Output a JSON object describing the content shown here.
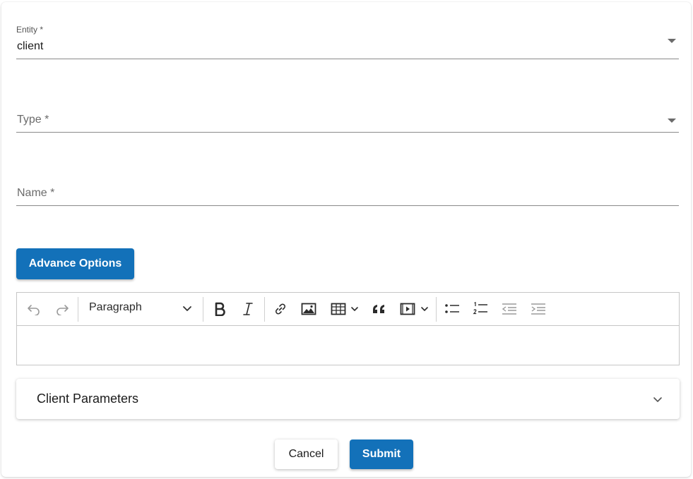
{
  "form": {
    "entity": {
      "label": "Entity *",
      "value": "client"
    },
    "type": {
      "placeholder": "Type *"
    },
    "name": {
      "placeholder": "Name *"
    },
    "advance_options_label": "Advance Options"
  },
  "editor": {
    "block_format": "Paragraph",
    "toolbar_icons": [
      "undo-icon",
      "redo-icon",
      "chevron-down-icon",
      "bold-icon",
      "italic-icon",
      "link-icon",
      "image-icon",
      "table-icon",
      "blockquote-icon",
      "media-icon",
      "bulleted-list-icon",
      "numbered-list-icon",
      "outdent-icon",
      "indent-icon"
    ],
    "content": ""
  },
  "accordion": {
    "title": "Client Parameters"
  },
  "actions": {
    "cancel_label": "Cancel",
    "submit_label": "Submit"
  },
  "colors": {
    "primary": "#1371b9",
    "border": "#c6c6c6",
    "text": "#1b1b1b"
  }
}
